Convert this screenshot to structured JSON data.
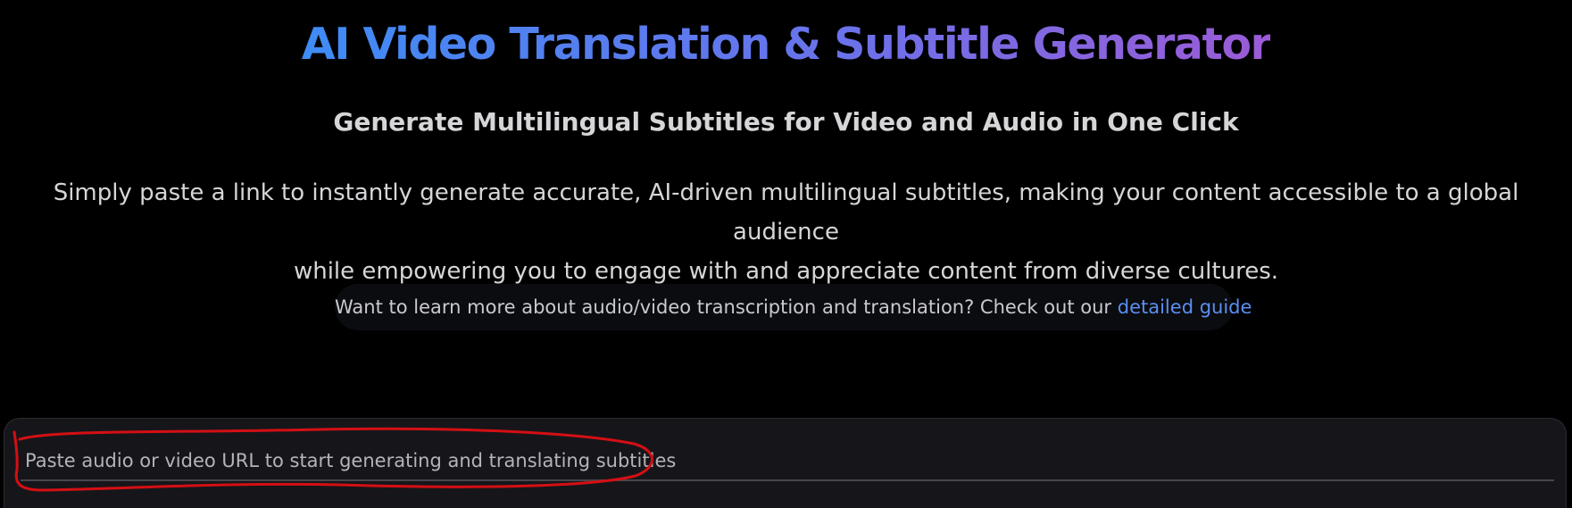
{
  "header": {
    "title": "AI Video Translation & Subtitle Generator",
    "subtitle": "Generate Multilingual Subtitles for Video and Audio in One Click",
    "description_line1": "Simply paste a link to instantly generate accurate, AI-driven multilingual subtitles, making your content accessible to a global audience",
    "description_line2": "while empowering you to engage with and appreciate content from diverse cultures."
  },
  "guide_banner": {
    "text": "Want to learn more about audio/video transcription and translation? Check out our ",
    "link_label": "detailed guide"
  },
  "url_form": {
    "placeholder": "Paste audio or video URL to start generating and translating subtitles",
    "value": ""
  },
  "colors": {
    "background": "#000000",
    "title_gradient_start": "#3f8cf5",
    "title_gradient_end": "#9b5bd6",
    "link": "#5b8ef0",
    "panel": "#16161a",
    "annotation_stroke": "#d40f14"
  }
}
